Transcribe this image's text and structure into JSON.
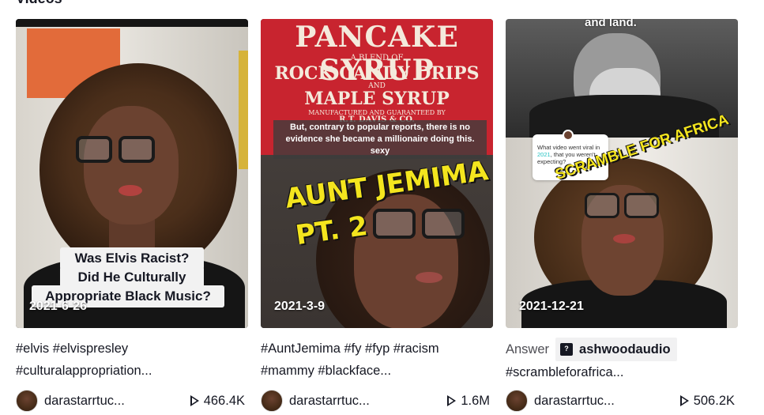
{
  "section": {
    "title": "Videos"
  },
  "videos": [
    {
      "date": "2021-6-26",
      "overlay_caption": [
        "Was Elvis Racist?",
        "Did He Culturally",
        "Appropriate Black Music?"
      ],
      "description": {
        "line1": "#elvis #elvispresley",
        "line2": "#culturalappropriation..."
      },
      "author": "darastarrtuc...",
      "views": "466.4K"
    },
    {
      "date": "2021-3-9",
      "label_art": {
        "title": "PANCAKE SYRUP",
        "sub1": "A BLEND OF",
        "line1": "ROCK CANDY DRIPS",
        "sub2": "AND",
        "line2": "MAPLE SYRUP",
        "sub3": "MANUFACTURED AND GUARANTEED BY",
        "maker": "R.T. DAVIS & CO."
      },
      "overlay_text": "But, contrary to popular reports, there is no evidence she became a millionaire doing this. sexy",
      "title_text": "AUNT JEMIMA",
      "part_text": "PT. 2",
      "description": {
        "line1": "#AuntJemima #fy #fyp #racism",
        "line2": "#mammy #blackface..."
      },
      "author": "darastarrtuc...",
      "views": "1.6M"
    },
    {
      "date": "2021-12-21",
      "top_text": "and land.",
      "question_card": {
        "pre": "What video went viral in ",
        "year": "2021",
        "post": ", that you weren't expecting?"
      },
      "scramble_text": "SCRAMBLE FOR AFRICA",
      "answer_label": "Answer",
      "answer_user": "ashwoodaudio",
      "description": {
        "line2": "#scrambleforafrica..."
      },
      "author": "darastarrtuc...",
      "views": "506.2K"
    }
  ],
  "colors": {
    "text": "#161823",
    "accent_yellow": "#f4e51e",
    "label_red": "#c8242f"
  },
  "icons": {
    "play": "play-icon",
    "answer": "question-bubble-icon"
  }
}
